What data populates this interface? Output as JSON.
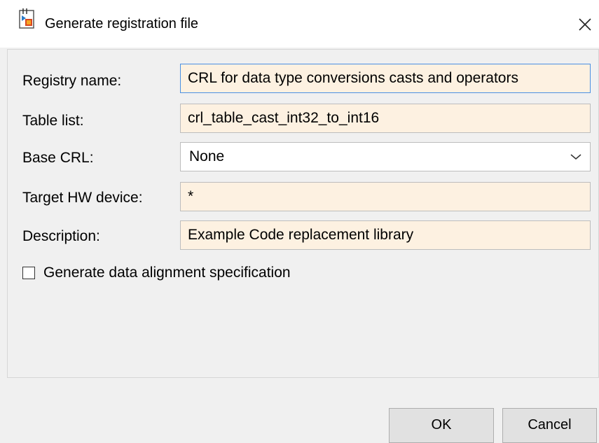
{
  "window": {
    "title": "Generate registration file",
    "icon": "registration-file-icon",
    "close_icon": "close-icon"
  },
  "form": {
    "registry_name": {
      "label": "Registry name:",
      "value": "CRL for data type conversions casts and operators"
    },
    "table_list": {
      "label": "Table list:",
      "value": "crl_table_cast_int32_to_int16"
    },
    "base_crl": {
      "label": "Base CRL:",
      "value": "None"
    },
    "target_hw_device": {
      "label": "Target HW device:",
      "value": "*"
    },
    "description": {
      "label": "Description:",
      "value": "Example Code replacement library"
    },
    "data_alignment": {
      "label": "Generate data alignment specification",
      "checked": false
    }
  },
  "buttons": {
    "ok": "OK",
    "cancel": "Cancel"
  },
  "colors": {
    "field_background": "#fdf1e1",
    "active_border": "#4a90e2",
    "dialog_background": "#f0f0f0"
  }
}
